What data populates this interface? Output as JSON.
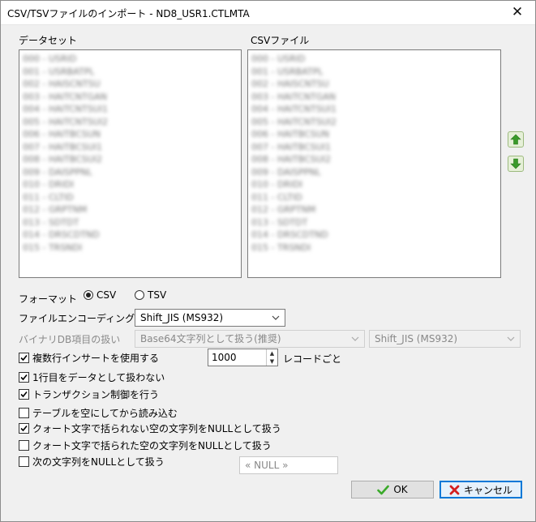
{
  "window": {
    "title": "CSV/TSVファイルのインポート - ND8_USR1.CTLMTA",
    "close_glyph": "✕"
  },
  "dataset": {
    "label": "データセット",
    "items": [
      "000 - USRID",
      "001 - USRBATPL",
      "002 - HAISCNTSU",
      "003 - HAITCNTGAN",
      "004 - HAITCNTSUI1",
      "005 - HAITCNTSUI2",
      "006 - HAITBCSUN",
      "007 - HAITBCSUI1",
      "008 - HAITBCSUI2",
      "009 - DAISPPNL",
      "010 - DRIDI",
      "011 - CLTID",
      "012 - GRPTNM",
      "013 - SDTDT",
      "014 - DRSCDTND",
      "015 - TRSNDI"
    ]
  },
  "csv_file": {
    "label": "CSVファイル",
    "items": [
      "000 - USRID",
      "001 - USRBATPL",
      "002 - HAISCNTSU",
      "003 - HAITCNTGAN",
      "004 - HAITCNTSUI1",
      "005 - HAITCNTSUI2",
      "006 - HAITBCSUN",
      "007 - HAITBCSUI1",
      "008 - HAITBCSUI2",
      "009 - DAISPPNL",
      "010 - DRIDI",
      "011 - CLTID",
      "012 - GRPTNM",
      "013 - SDTDT",
      "014 - DRSCDTND",
      "015 - TRSNDI"
    ]
  },
  "move_buttons": {
    "up_icon": "arrow-up-icon",
    "down_icon": "arrow-down-icon",
    "color": "#3a9a2a"
  },
  "format": {
    "label": "フォーマット",
    "options": [
      "CSV",
      "TSV"
    ],
    "selected": "CSV"
  },
  "encoding": {
    "label": "ファイルエンコーディング",
    "value": "Shift_JIS (MS932)"
  },
  "binary": {
    "label": "バイナリDB項目の扱い",
    "mode": "Base64文字列として扱う(推奨)",
    "encoding": "Shift_JIS (MS932)"
  },
  "options": {
    "multi_insert": {
      "label": "複数行インサートを使用する",
      "checked": true,
      "count": "1000",
      "unit": "レコードごと"
    },
    "first_row": {
      "label": "1行目をデータとして扱わない",
      "checked": true
    },
    "transaction": {
      "label": "トランザクション制御を行う",
      "checked": true
    },
    "truncate": {
      "label": "テーブルを空にしてから読み込む",
      "checked": false
    },
    "unquoted_empty_null": {
      "label": "クォート文字で括られない空の文字列をNULLとして扱う",
      "checked": true
    },
    "quoted_empty_null": {
      "label": "クォート文字で括られた空の文字列をNULLとして扱う",
      "checked": false
    },
    "custom_null": {
      "label": "次の文字列をNULLとして扱う",
      "checked": false,
      "placeholder": "« NULL »"
    }
  },
  "buttons": {
    "ok": "OK",
    "cancel": "キャンセル",
    "ok_color": "#3aaa2a",
    "cancel_color": "#d42020"
  }
}
